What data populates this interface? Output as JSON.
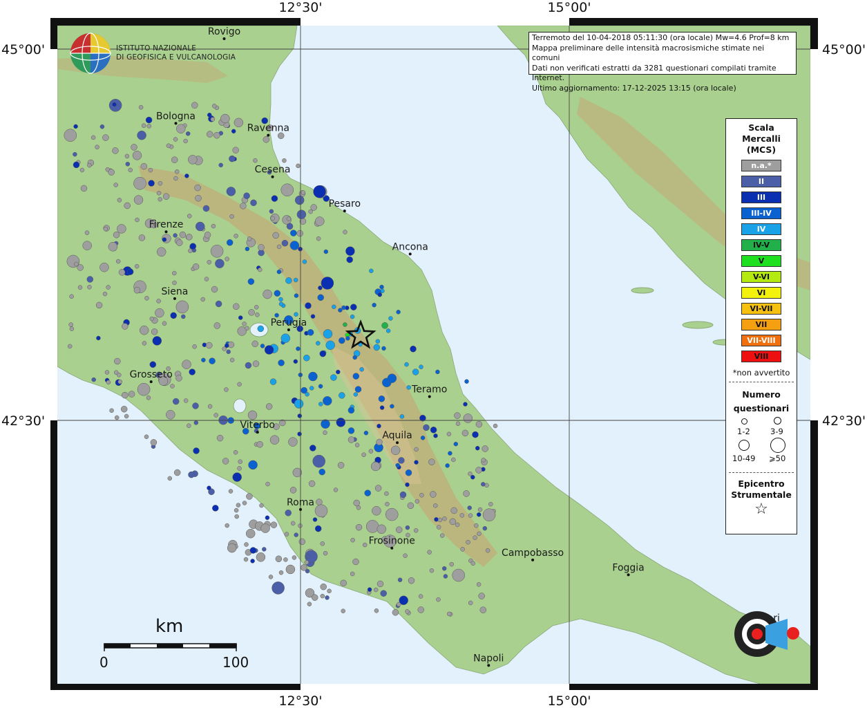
{
  "map": {
    "axis": {
      "lon_labels": [
        "12°30'",
        "15°00'"
      ],
      "lat_labels": [
        "45°00'",
        "42°30'"
      ]
    },
    "cities": [
      {
        "name": "Rovigo",
        "lon": 11.79,
        "lat": 45.07
      },
      {
        "name": "Bologna",
        "lon": 11.34,
        "lat": 44.5
      },
      {
        "name": "Ravenna",
        "lon": 12.2,
        "lat": 44.42
      },
      {
        "name": "Cesena",
        "lon": 12.24,
        "lat": 44.14
      },
      {
        "name": "Pesaro",
        "lon": 12.91,
        "lat": 43.91
      },
      {
        "name": "Firenze",
        "lon": 11.25,
        "lat": 43.77
      },
      {
        "name": "Ancona",
        "lon": 13.52,
        "lat": 43.62
      },
      {
        "name": "Siena",
        "lon": 11.33,
        "lat": 43.32
      },
      {
        "name": "Perugia",
        "lon": 12.39,
        "lat": 43.11
      },
      {
        "name": "Grosseto",
        "lon": 11.11,
        "lat": 42.76
      },
      {
        "name": "Teramo",
        "lon": 13.7,
        "lat": 42.66
      },
      {
        "name": "Viterbo",
        "lon": 12.1,
        "lat": 42.42
      },
      {
        "name": "Aquila",
        "lon": 13.4,
        "lat": 42.35
      },
      {
        "name": "Roma",
        "lon": 12.5,
        "lat": 41.9
      },
      {
        "name": "Frosinone",
        "lon": 13.35,
        "lat": 41.64
      },
      {
        "name": "Campobasso",
        "lon": 14.66,
        "lat": 41.56
      },
      {
        "name": "Foggia",
        "lon": 15.55,
        "lat": 41.46
      },
      {
        "name": "Napoli",
        "lon": 14.25,
        "lat": 40.85
      },
      {
        "name": "Bari",
        "lon": 16.87,
        "lat": 41.12
      }
    ],
    "epicenter": {
      "lon": 13.06,
      "lat": 43.07
    }
  },
  "institute": {
    "line1": "ISTITUTO NAZIONALE",
    "line2": "DI GEOFISICA E VULCANOLOGIA"
  },
  "info": {
    "line1": "Terremoto del 10-04-2018 05:11:30 (ora locale) Mw=4.6 Prof=8 km",
    "line2": "Mappa preliminare delle intensità macrosismiche stimate nei comuni",
    "line3": "Dati non verificati estratti da 3281 questionari compilati tramite Internet.",
    "line4": "Ultimo aggiornamento: 17-12-2025 13:15 (ora locale)"
  },
  "legend": {
    "title1": "Scala",
    "title2": "Mercalli",
    "title3": "(MCS)",
    "classes": [
      {
        "label": "n.a.*",
        "color": "#9e9e9e",
        "text": "#ffffff"
      },
      {
        "label": "II",
        "color": "#4b5fa8",
        "text": "#ffffff"
      },
      {
        "label": "III",
        "color": "#0a2fb0",
        "text": "#ffffff"
      },
      {
        "label": "III-IV",
        "color": "#0a62d0",
        "text": "#ffffff"
      },
      {
        "label": "IV",
        "color": "#1aa2e8",
        "text": "#ffffff"
      },
      {
        "label": "IV-V",
        "color": "#22b04a",
        "text": "#111111"
      },
      {
        "label": "V",
        "color": "#1fe01f",
        "text": "#111111"
      },
      {
        "label": "V-VI",
        "color": "#b4ea10",
        "text": "#111111"
      },
      {
        "label": "VI",
        "color": "#f2f20c",
        "text": "#111111"
      },
      {
        "label": "VI-VII",
        "color": "#f5c010",
        "text": "#111111"
      },
      {
        "label": "VII",
        "color": "#f5a010",
        "text": "#111111"
      },
      {
        "label": "VII-VIII",
        "color": "#f07010",
        "text": "#ffffff"
      },
      {
        "label": "VIII",
        "color": "#ee1010",
        "text": "#111111"
      }
    ],
    "note": "*non avvertito",
    "count_title1": "Numero",
    "count_title2": "questionari",
    "count_classes": [
      "1-2",
      "3-9",
      "10-49",
      "⩾50"
    ],
    "epi_title1": "Epicentro",
    "epi_title2": "Strumentale"
  },
  "scalebar": {
    "unit": "km",
    "ticks": [
      "0",
      "100"
    ]
  },
  "colors": {
    "sea": "#e2f1fb",
    "land": "#a6cf8e",
    "land_light": "#c6dca0",
    "mountain": "#c9a070",
    "frame": "#000000"
  }
}
